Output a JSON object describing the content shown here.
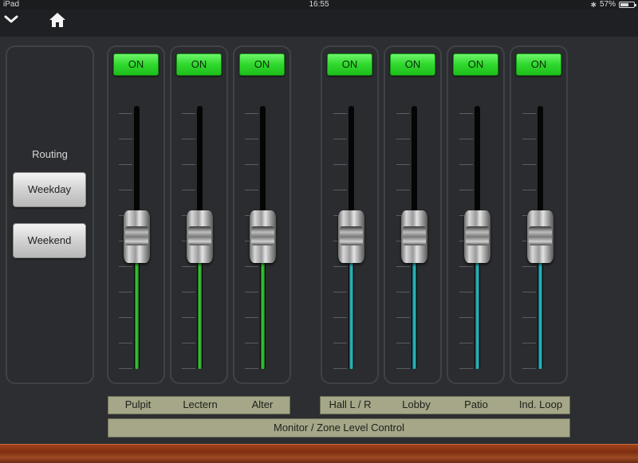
{
  "status_bar": {
    "device": "iPad",
    "time": "16:55",
    "battery": "57%",
    "battery_level": 0.57
  },
  "nav": {
    "chevron_icon": "chevron-down-icon",
    "home_icon": "home-icon"
  },
  "routing": {
    "label": "Routing",
    "buttons": [
      "Weekday",
      "Weekend"
    ]
  },
  "channels": [
    {
      "label": "Pulpit",
      "on_label": "ON",
      "color": "#3ed23c"
    },
    {
      "label": "Lectern",
      "on_label": "ON",
      "color": "#3ed23c"
    },
    {
      "label": "Alter",
      "on_label": "ON",
      "color": "#3ed23c"
    },
    {
      "label": "Hall L / R",
      "on_label": "ON",
      "color": "#30c5cc"
    },
    {
      "label": "Lobby",
      "on_label": "ON",
      "color": "#30c5cc"
    },
    {
      "label": "Patio",
      "on_label": "ON",
      "color": "#30c5cc"
    },
    {
      "label": "Ind. Loop",
      "on_label": "ON",
      "color": "#30c5cc"
    }
  ],
  "footer": {
    "title": "Monitor / Zone Level Control"
  },
  "colors": {
    "on_green": "#2fd82c",
    "label_bar": "#a5a788",
    "background": "#2c2e31"
  }
}
